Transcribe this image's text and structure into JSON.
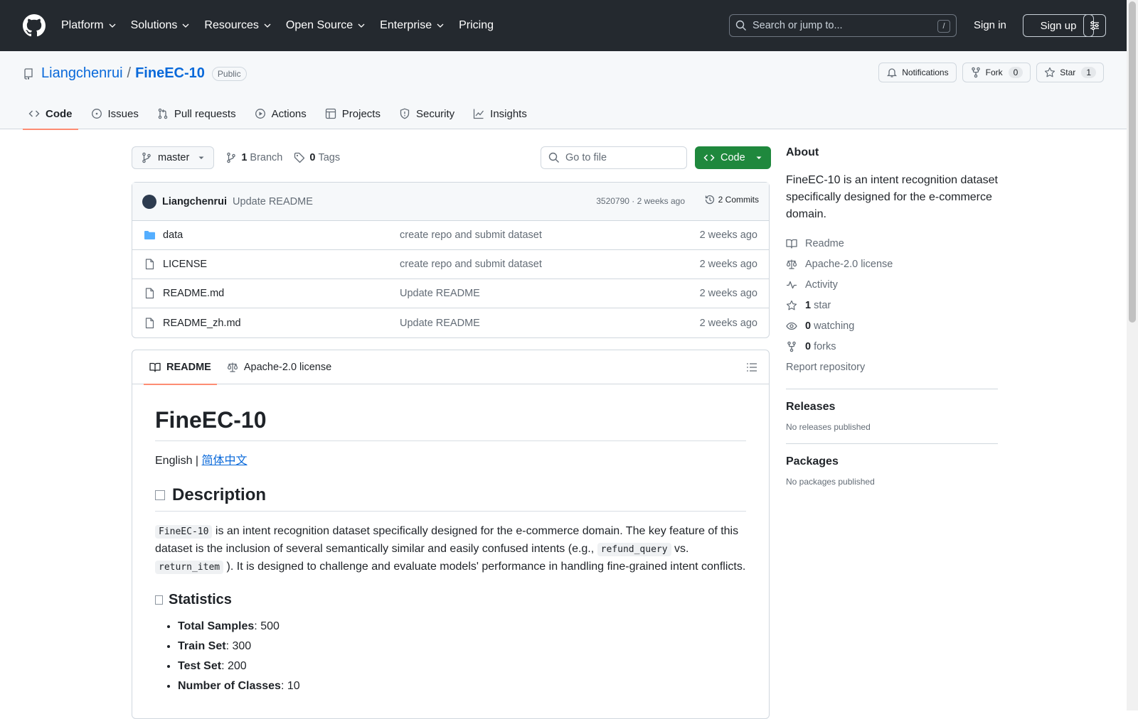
{
  "header": {
    "nav": [
      "Platform",
      "Solutions",
      "Resources",
      "Open Source",
      "Enterprise",
      "Pricing"
    ],
    "search_placeholder": "Search or jump to...",
    "search_shortcut": "/",
    "sign_in": "Sign in",
    "sign_up": "Sign up"
  },
  "repo": {
    "owner": "Liangchenrui",
    "separator": "/",
    "name": "FineEC-10",
    "visibility": "Public",
    "notifications": "Notifications",
    "fork_label": "Fork",
    "fork_count": "0",
    "star_label": "Star",
    "star_count": "1",
    "tabs": [
      "Code",
      "Issues",
      "Pull requests",
      "Actions",
      "Projects",
      "Security",
      "Insights"
    ]
  },
  "toolbar": {
    "branch": "master",
    "branch_count": "1",
    "branch_label": "Branch",
    "tag_count": "0",
    "tag_label": "Tags",
    "go_to_file": "Go to file",
    "code_button": "Code"
  },
  "commit": {
    "author": "Liangchenrui",
    "message": "Update README",
    "meta": "3520790 · 2 weeks ago",
    "commits": "2 Commits"
  },
  "files": [
    {
      "name": "data",
      "type": "folder",
      "message": "create repo and submit dataset",
      "date": "2 weeks ago"
    },
    {
      "name": "LICENSE",
      "type": "file",
      "message": "create repo and submit dataset",
      "date": "2 weeks ago"
    },
    {
      "name": "README.md",
      "type": "file",
      "message": "Update README",
      "date": "2 weeks ago"
    },
    {
      "name": "README_zh.md",
      "type": "file",
      "message": "Update README",
      "date": "2 weeks ago"
    }
  ],
  "readme": {
    "tab_readme": "README",
    "tab_license": "Apache-2.0 license",
    "title": "FineEC-10",
    "lang_english": "English |",
    "lang_zh": "简体中文",
    "description_heading": "Description",
    "desc_code1": "FineEC-10",
    "desc_part1": " is an intent recognition dataset specifically designed for the e-commerce domain. The key feature of this dataset is the inclusion of several semantically similar and easily confused intents (e.g., ",
    "desc_code2": "refund_query",
    "desc_part2": " vs. ",
    "desc_code3": "return_item",
    "desc_part3": " ). It is designed to challenge and evaluate models' performance in handling fine-grained intent conflicts.",
    "stats_heading": "Statistics",
    "stats": [
      {
        "label": "Total Samples",
        "value": ": 500"
      },
      {
        "label": "Train Set",
        "value": ": 300"
      },
      {
        "label": "Test Set",
        "value": ": 200"
      },
      {
        "label": "Number of Classes",
        "value": ": 10"
      }
    ]
  },
  "sidebar": {
    "about_heading": "About",
    "about_text": "FineEC-10 is an intent recognition dataset specifically designed for the e-commerce domain.",
    "readme": "Readme",
    "license": "Apache-2.0 license",
    "activity": "Activity",
    "stars_count": "1",
    "stars_label": "star",
    "watching_count": "0",
    "watching_label": "watching",
    "forks_count": "0",
    "forks_label": "forks",
    "report": "Report repository",
    "releases_heading": "Releases",
    "releases_text": "No releases published",
    "packages_heading": "Packages",
    "packages_text": "No packages published"
  }
}
